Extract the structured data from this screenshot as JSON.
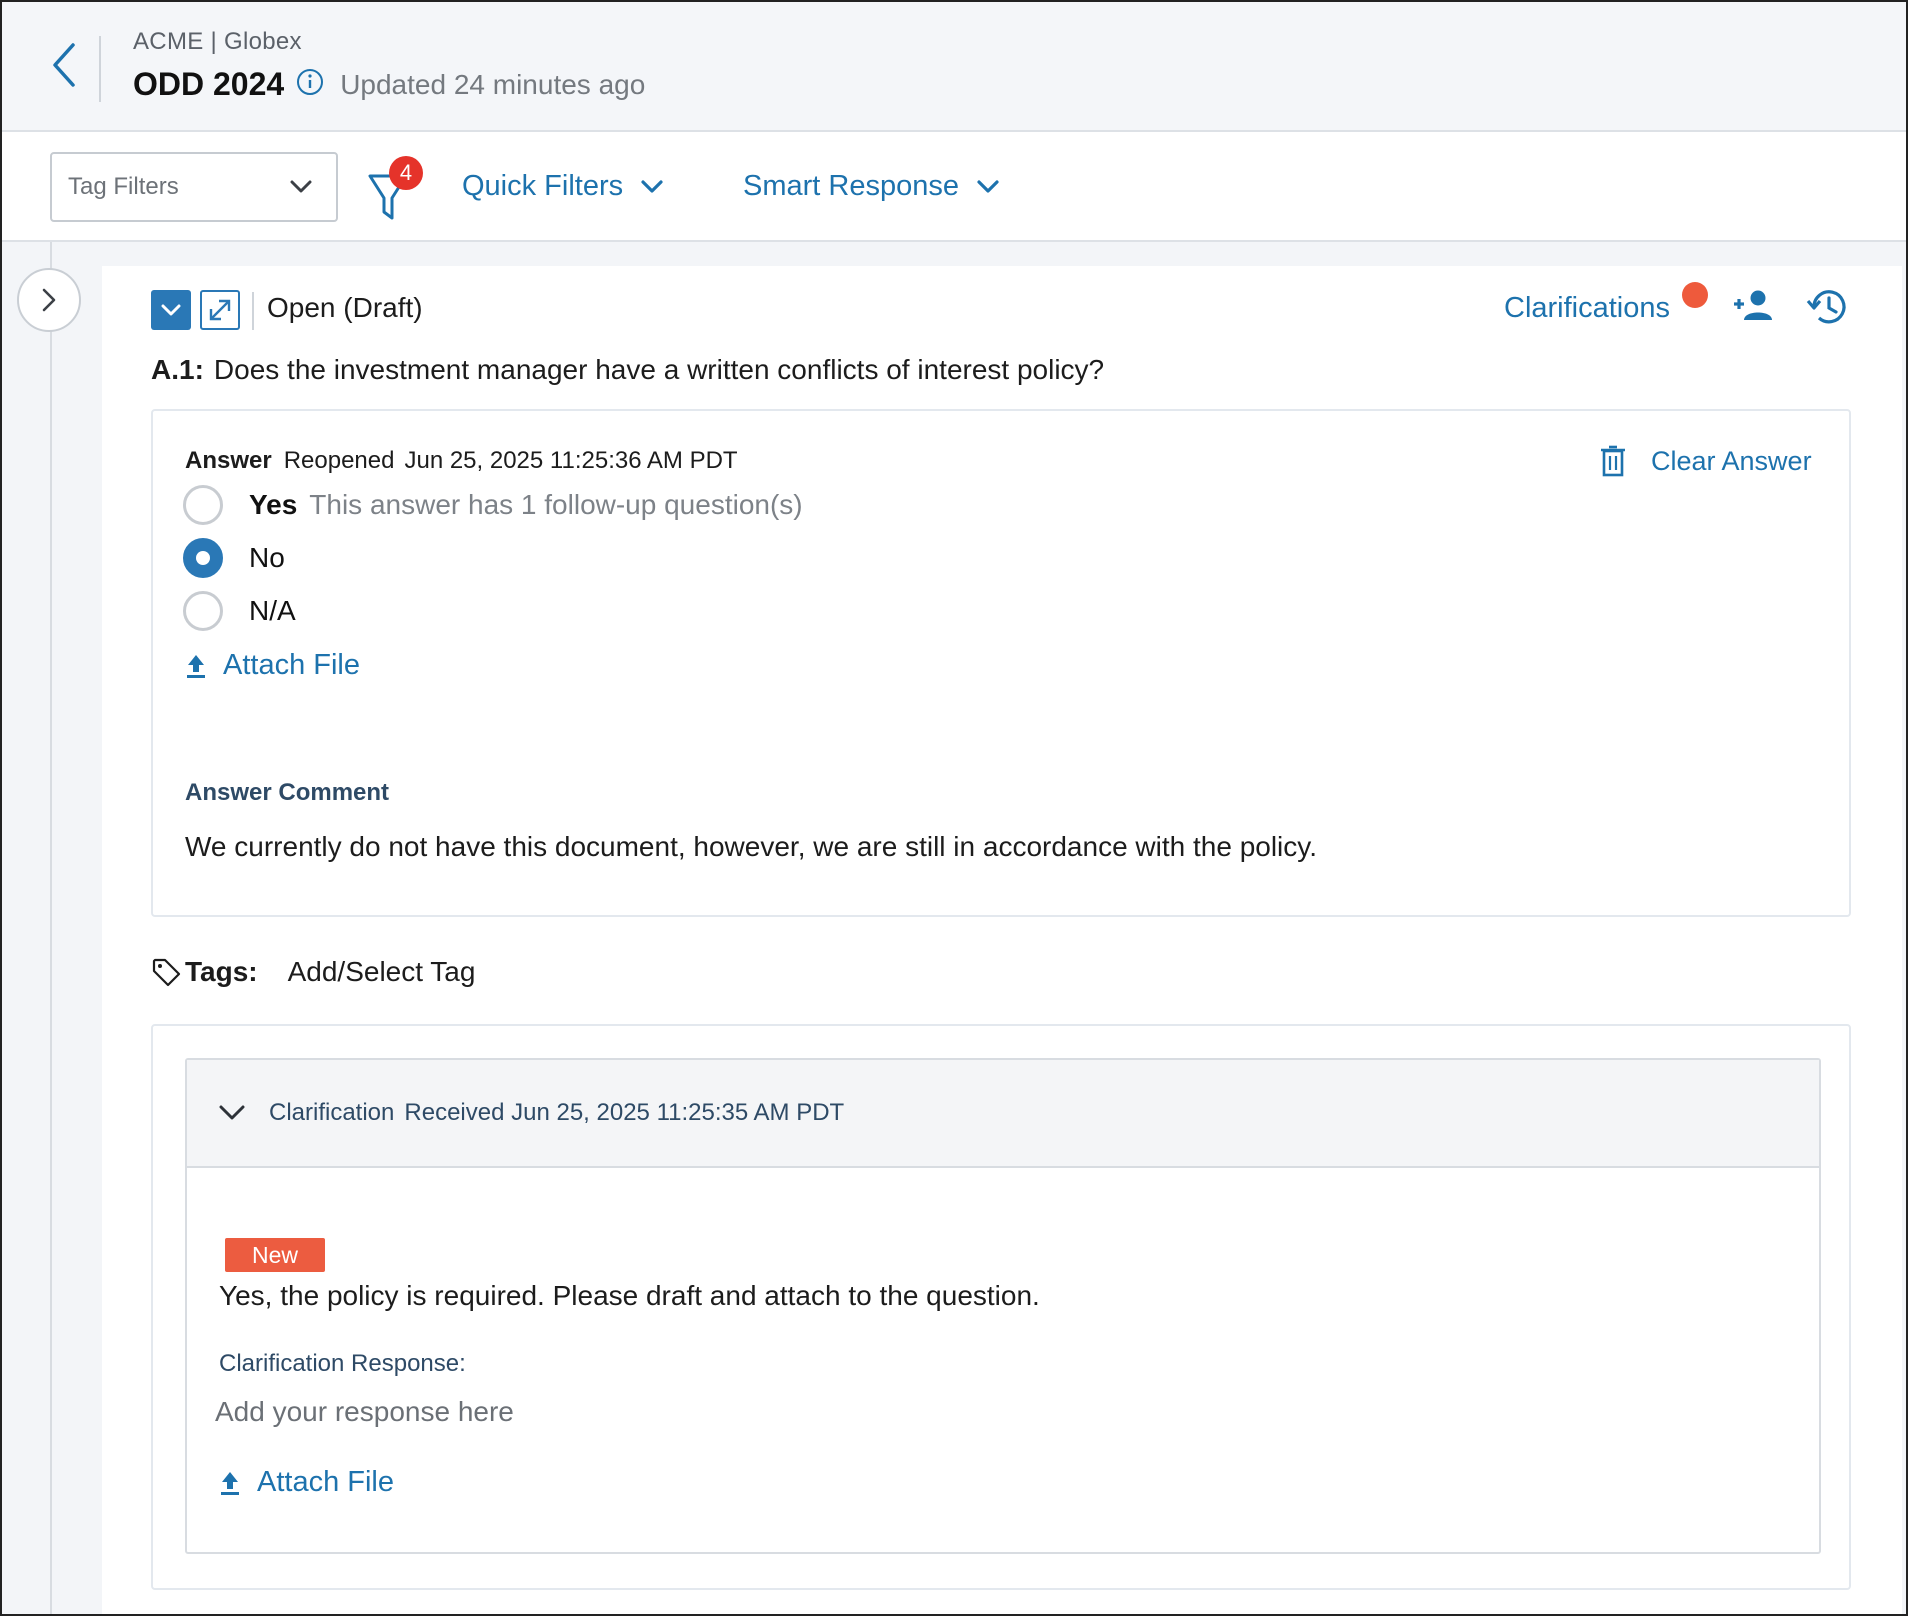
{
  "header": {
    "breadcrumb": "ACME | Globex",
    "title": "ODD 2024",
    "updated": "Updated 24 minutes ago"
  },
  "toolbar": {
    "tag_filters_placeholder": "Tag Filters",
    "filter_count": "4",
    "quick_filters": "Quick Filters",
    "smart_response": "Smart Response"
  },
  "question": {
    "status": "Open (Draft)",
    "clarifications_label": "Clarifications",
    "id": "A.1:",
    "text": "Does the investment manager have a written conflicts of interest policy?",
    "answer": {
      "label": "Answer",
      "state": "Reopened",
      "timestamp": "Jun 25, 2025 11:25:36 AM PDT",
      "clear_label": "Clear Answer",
      "options": [
        {
          "label": "Yes",
          "note": "This answer has 1 follow-up question(s)",
          "selected": false
        },
        {
          "label": "No",
          "note": "",
          "selected": true
        },
        {
          "label": "N/A",
          "note": "",
          "selected": false
        }
      ],
      "attach_label": "Attach File",
      "comment_label": "Answer Comment",
      "comment": "We currently do not have this document, however, we are still in accordance with the policy."
    },
    "tags": {
      "label": "Tags:",
      "add_label": "Add/Select Tag"
    },
    "clarification": {
      "title": "Clarification",
      "received": "Received Jun 25, 2025 11:25:35 AM PDT",
      "badge": "New",
      "text": "Yes, the policy is required. Please draft and attach to the question.",
      "response_label": "Clarification Response:",
      "response_placeholder": "Add your response here",
      "attach_label": "Attach File"
    }
  },
  "colors": {
    "accent": "#1d72ad",
    "primary_button": "#2a78b6",
    "badge_red": "#e5332a",
    "new_badge": "#ec5c40"
  }
}
